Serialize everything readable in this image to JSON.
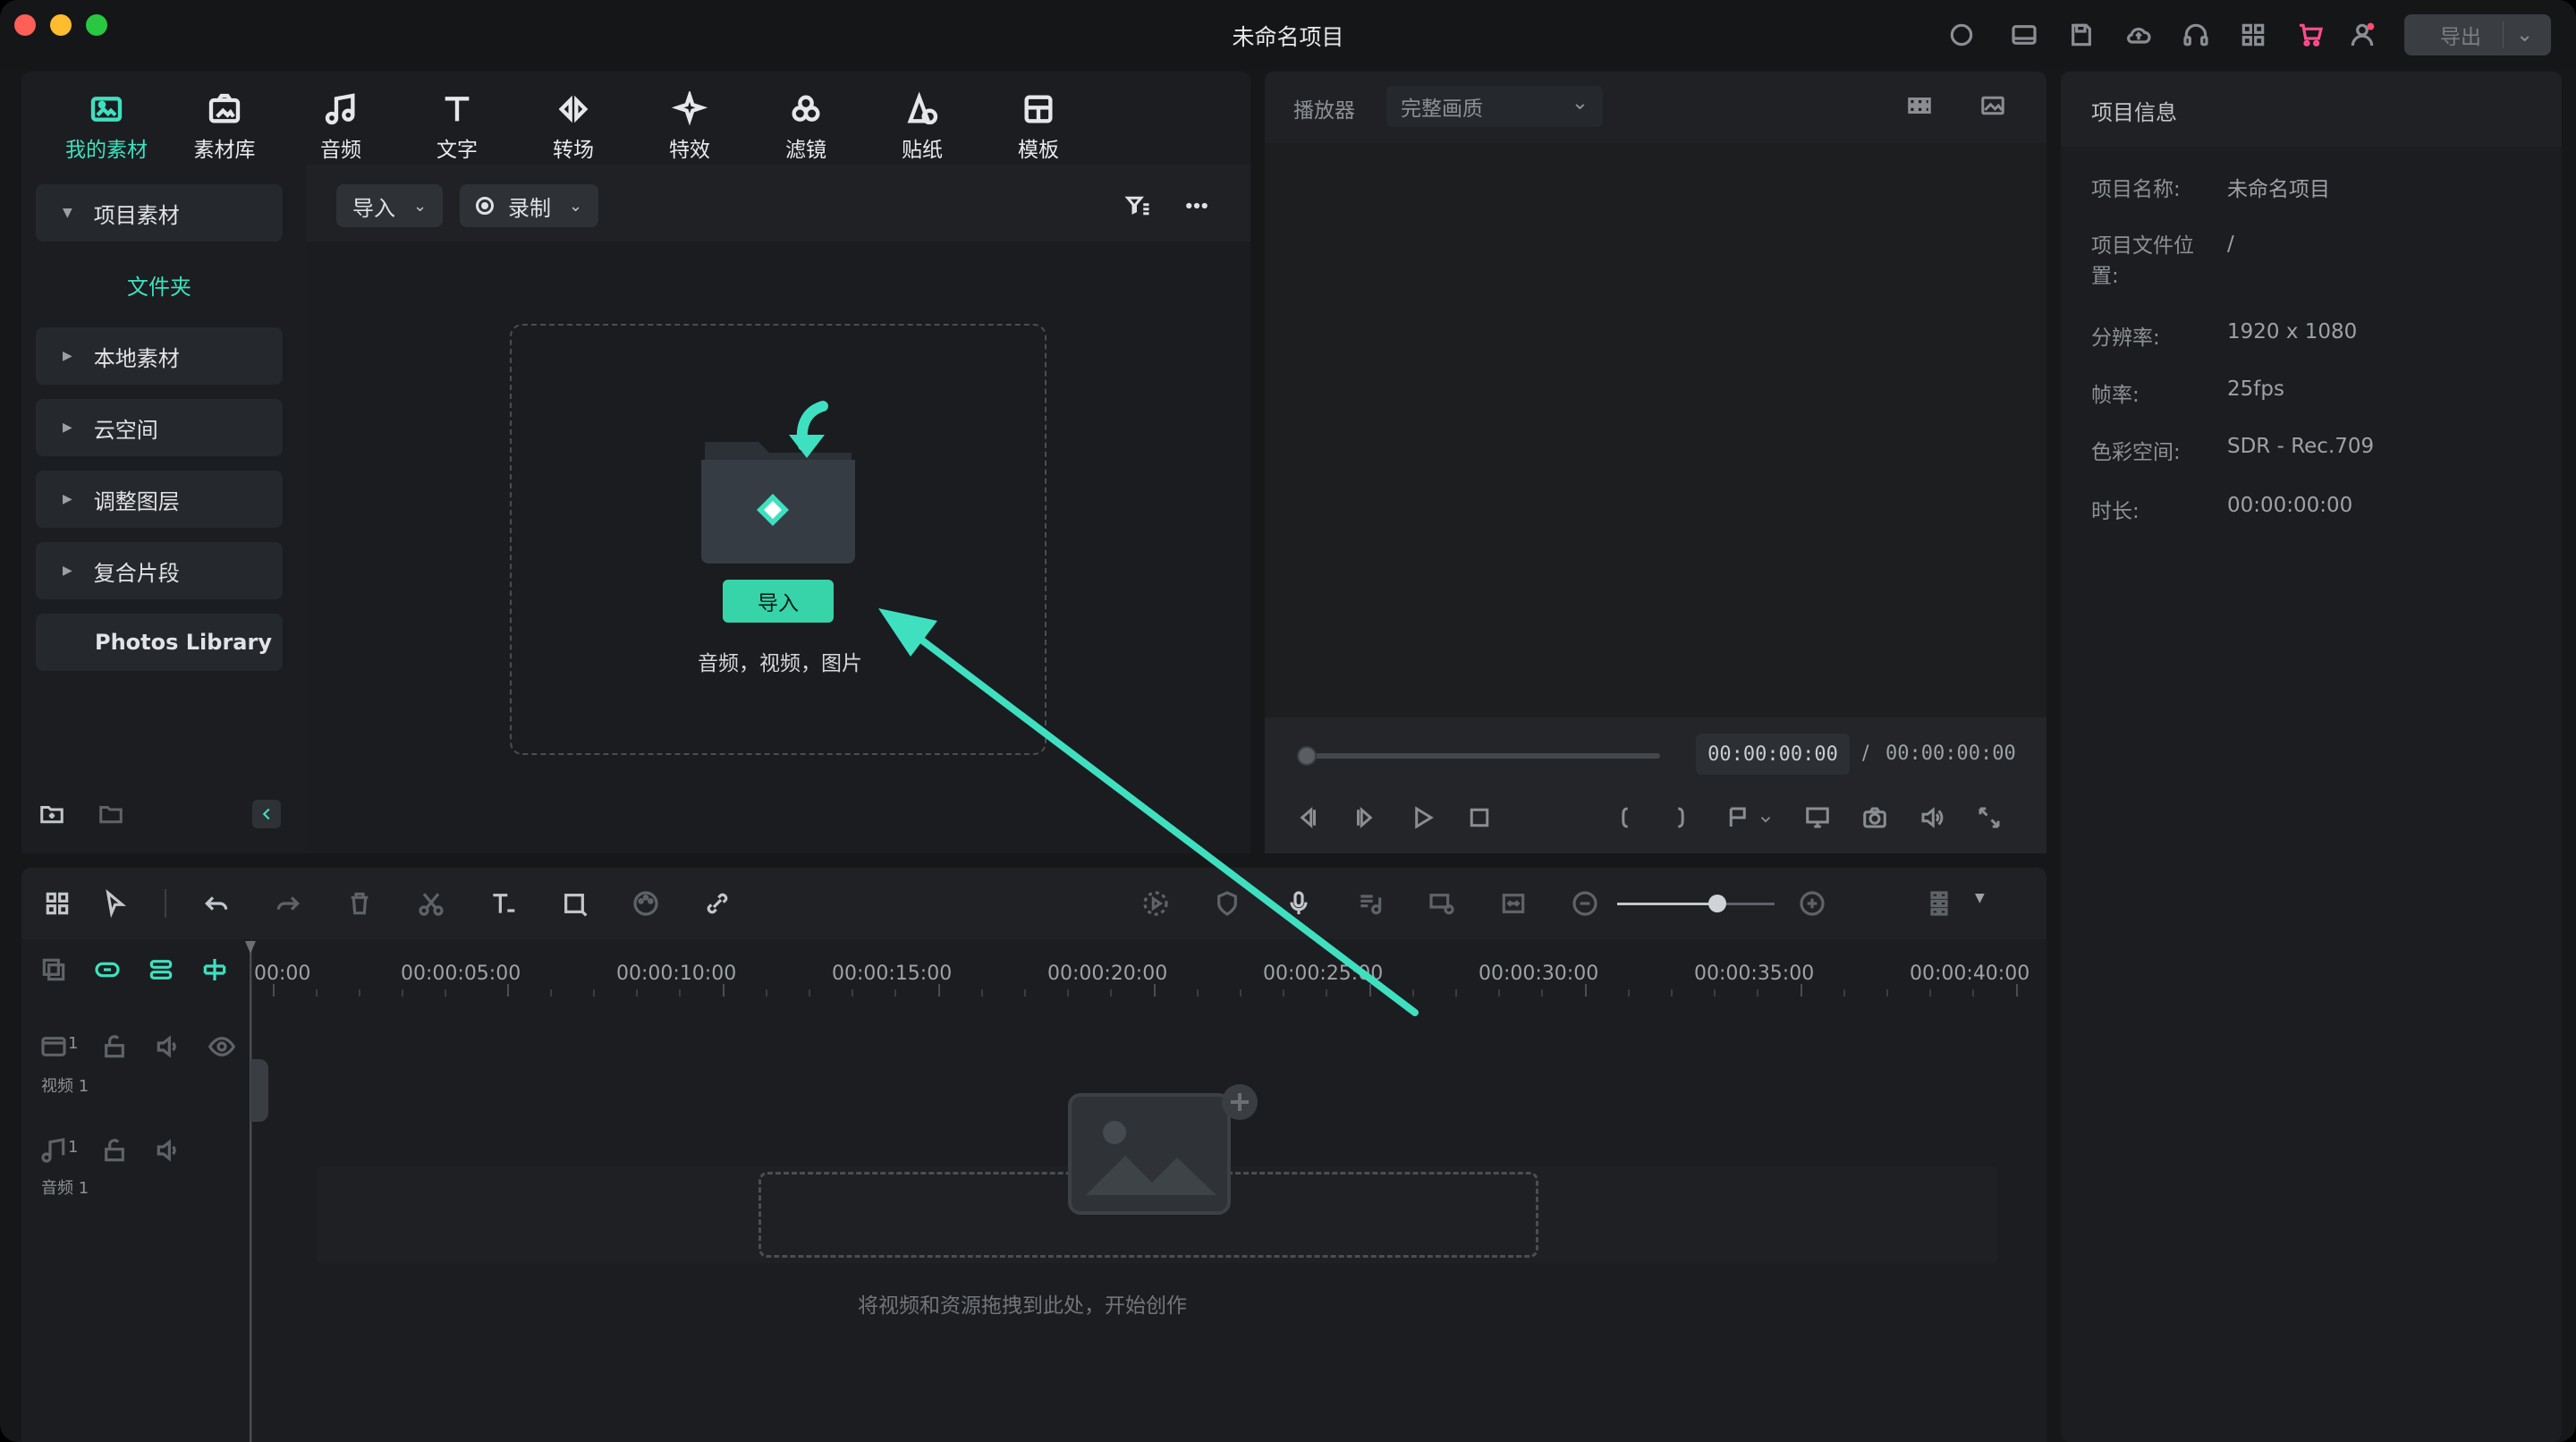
{
  "window": {
    "title": "未命名项目"
  },
  "toolbar_right": {
    "icons": [
      "record-circle-icon",
      "layout-icon",
      "save-icon",
      "cloud-upload-icon",
      "headset-icon",
      "apps-grid-icon",
      "cart-icon",
      "account-icon"
    ],
    "export_label": "导出"
  },
  "media_tabs": [
    {
      "label": "我的素材",
      "icon": "my-media-icon",
      "active": true
    },
    {
      "label": "素材库",
      "icon": "stock-media-icon"
    },
    {
      "label": "音频",
      "icon": "music-note-icon"
    },
    {
      "label": "文字",
      "icon": "text-t-icon"
    },
    {
      "label": "转场",
      "icon": "transition-icon"
    },
    {
      "label": "特效",
      "icon": "effects-sparkle-icon"
    },
    {
      "label": "滤镜",
      "icon": "filter-icon"
    },
    {
      "label": "贴纸",
      "icon": "sticker-icon"
    },
    {
      "label": "模板",
      "icon": "template-icon"
    }
  ],
  "sidebar": {
    "project_media": "项目素材",
    "folder": "文件夹",
    "items": [
      "本地素材",
      "云空间",
      "调整图层",
      "复合片段"
    ],
    "photos_library": "Photos Library"
  },
  "media_toolbar": {
    "import_label": "导入",
    "record_label": "录制"
  },
  "dropzone": {
    "button": "导入",
    "caption": "音频，视频，图片"
  },
  "player": {
    "label": "播放器",
    "quality": "完整画质",
    "current_time": "00:00:00:00",
    "separator": "/",
    "total_time": "00:00:00:00"
  },
  "project_info": {
    "header": "项目信息",
    "rows": [
      {
        "label": "项目名称:",
        "value": "未命名项目"
      },
      {
        "label": "项目文件位置:",
        "value": "/"
      },
      {
        "label": "分辨率:",
        "value": "1920 x 1080"
      },
      {
        "label": "帧率:",
        "value": "25fps"
      },
      {
        "label": "色彩空间:",
        "value": "SDR - Rec.709"
      },
      {
        "label": "时长:",
        "value": "00:00:00:00"
      }
    ]
  },
  "timeline": {
    "ruler": [
      "00:00",
      "00:00:05:00",
      "00:00:10:00",
      "00:00:15:00",
      "00:00:20:00",
      "00:00:25:00",
      "00:00:30:00",
      "00:00:35:00",
      "00:00:40:00"
    ],
    "tracks": [
      {
        "num": "1",
        "label": "视频 1"
      },
      {
        "num": "1",
        "label": "音频 1"
      }
    ],
    "drop_caption": "将视频和资源拖拽到此处，开始创作"
  },
  "colors": {
    "accent": "#3fe0c0",
    "import_button": "#37d3a9",
    "background": "#151719"
  }
}
